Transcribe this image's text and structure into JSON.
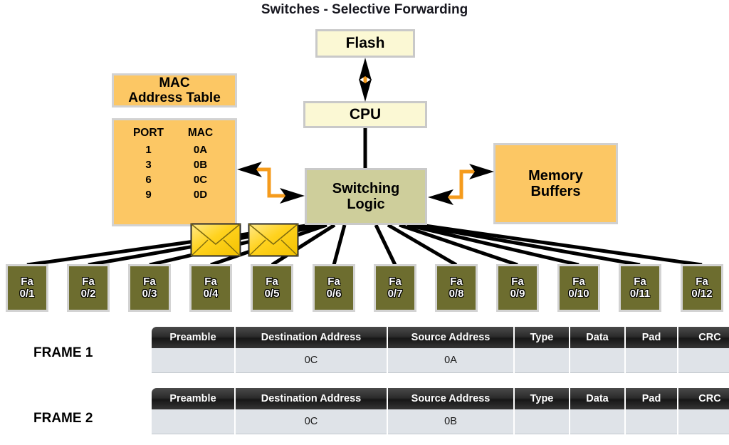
{
  "title": "Switches - Selective Forwarding",
  "colors": {
    "orange_box": "#FCC764",
    "pale_yellow_box": "#FBF8D4",
    "khaki_box": "#CECE9B",
    "port_olive": "#6D6D2F",
    "connector_orange": "#F59B1C",
    "link_black": "#000000",
    "envelope_gold": "#FFD21E",
    "table_header_dark": "#2C2C2C",
    "table_row_gray": "#DFE3E8"
  },
  "components": {
    "flash": "Flash",
    "cpu": "CPU",
    "switching_logic_line1": "Switching",
    "switching_logic_line2": "Logic",
    "memory_buffers_line1": "Memory",
    "memory_buffers_line2": "Buffers"
  },
  "mac_table": {
    "title_line1": "MAC",
    "title_line2": "Address Table",
    "headers": [
      "PORT",
      "MAC"
    ],
    "rows": [
      {
        "port": "1",
        "mac": "0A"
      },
      {
        "port": "3",
        "mac": "0B"
      },
      {
        "port": "6",
        "mac": "0C"
      },
      {
        "port": "9",
        "mac": "0D"
      }
    ]
  },
  "ports": [
    {
      "line1": "Fa",
      "line2": "0/1"
    },
    {
      "line1": "Fa",
      "line2": "0/2"
    },
    {
      "line1": "Fa",
      "line2": "0/3"
    },
    {
      "line1": "Fa",
      "line2": "0/4"
    },
    {
      "line1": "Fa",
      "line2": "0/5"
    },
    {
      "line1": "Fa",
      "line2": "0/6"
    },
    {
      "line1": "Fa",
      "line2": "0/7"
    },
    {
      "line1": "Fa",
      "line2": "0/8"
    },
    {
      "line1": "Fa",
      "line2": "0/9"
    },
    {
      "line1": "Fa",
      "line2": "0/10"
    },
    {
      "line1": "Fa",
      "line2": "0/11"
    },
    {
      "line1": "Fa",
      "line2": "0/12"
    }
  ],
  "frames": [
    {
      "label": "FRAME 1",
      "headers": [
        "Preamble",
        "Destination Address",
        "Source Address",
        "Type",
        "Data",
        "Pad",
        "CRC"
      ],
      "values": [
        "",
        "0C",
        "0A",
        "",
        "",
        "",
        ""
      ]
    },
    {
      "label": "FRAME 2",
      "headers": [
        "Preamble",
        "Destination Address",
        "Source Address",
        "Type",
        "Data",
        "Pad",
        "CRC"
      ],
      "values": [
        "",
        "0C",
        "0B",
        "",
        "",
        "",
        ""
      ]
    }
  ],
  "envelopes": [
    {
      "name": "frame-envelope-1"
    },
    {
      "name": "frame-envelope-2"
    }
  ]
}
